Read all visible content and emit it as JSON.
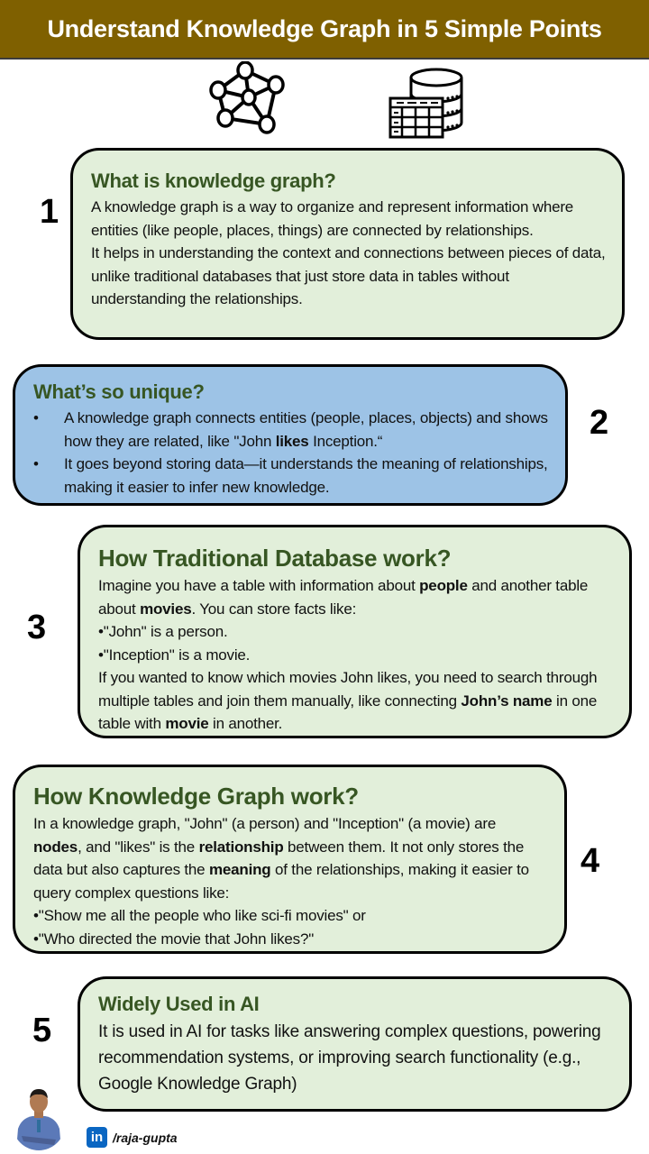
{
  "title": "Understand Knowledge Graph in 5 Simple Points",
  "icons": [
    "knowledge-graph-network-icon",
    "database-table-icon"
  ],
  "colors": {
    "banner": "#7f6000",
    "heading": "#375623",
    "card_green": "#e2efda",
    "card_blue": "#9dc3e6",
    "linkedin": "#0a66c2"
  },
  "points": [
    {
      "number": "1",
      "heading": "What is knowledge graph?",
      "paragraphs": [
        "A knowledge graph is a way to organize and represent information where entities (like people, places, things) are connected by relationships.",
        "It helps in understanding the context and connections between pieces of data, unlike traditional databases that just store data in tables without understanding the relationships."
      ]
    },
    {
      "number": "2",
      "heading": "What’s so unique?",
      "bullets": [
        {
          "before": "A knowledge graph connects entities (people, places, objects) and shows how they are related, like \"John ",
          "bold": "likes",
          "after": " Inception.“"
        },
        {
          "text": "It goes beyond storing data—it understands the meaning of relationships, making it easier to infer new knowledge."
        }
      ]
    },
    {
      "number": "3",
      "heading": "How Traditional Database work?",
      "intro": {
        "t1": "Imagine you have a table with information about ",
        "b1": "people",
        "t2": " and another table about ",
        "b2": "movies",
        "t3": ". You can store facts like:"
      },
      "facts": [
        "•\"John\" is a person.",
        "•\"Inception\" is a movie."
      ],
      "outro": {
        "t1": "If you wanted to know which movies John likes, you need to search through multiple tables and join them manually, like connecting ",
        "b1": "John’s name",
        "t2": " in one table with ",
        "b2": "movie",
        "t3": " in another."
      }
    },
    {
      "number": "4",
      "heading": "How Knowledge Graph work?",
      "body": {
        "t1": "In a knowledge graph, \"John\" (a person) and \"Inception\" (a movie) are ",
        "b1": "nodes",
        "t2": ", and \"likes\" is the ",
        "b2": "relationship",
        "t3": "  between them. It not only stores the data but also captures the ",
        "b3": "meaning",
        "t4": " of the relationships, making it easier to query complex questions like:"
      },
      "examples": [
        "•\"Show me all the people who like sci-fi movies\" or",
        "•\"Who directed the movie that John likes?\""
      ]
    },
    {
      "number": "5",
      "heading": "Widely Used in AI",
      "paragraph": "It is used in AI for tasks like answering complex questions, powering recommendation systems, or improving search functionality (e.g., Google Knowledge Graph)"
    }
  ],
  "author": {
    "avatar": "author-photo",
    "linkedin_badge": "in",
    "handle": "/raja-gupta"
  }
}
